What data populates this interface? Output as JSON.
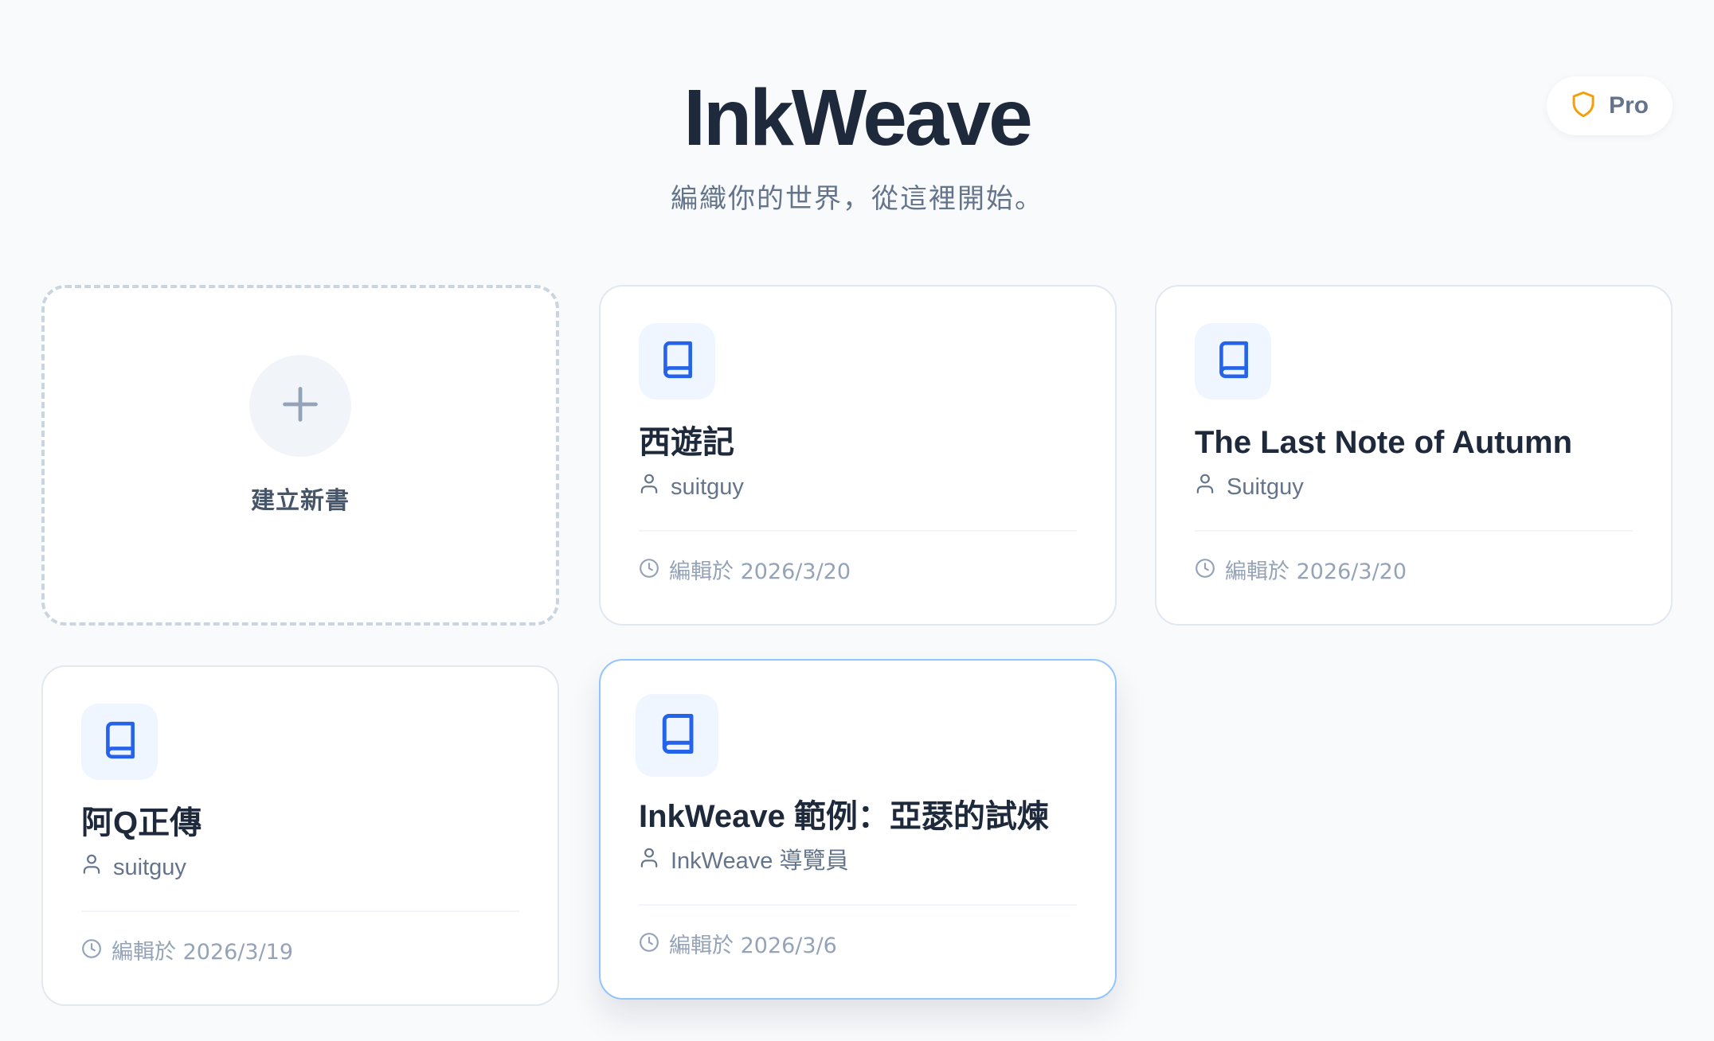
{
  "header": {
    "title": "InkWeave",
    "subtitle": "編織你的世界，從這裡開始。",
    "pro_label": "Pro"
  },
  "new_book": {
    "label": "建立新書"
  },
  "books": [
    {
      "title": "西遊記",
      "author": "suitguy",
      "edited": "編輯於 2026/3/20"
    },
    {
      "title": "The Last Note of Autumn",
      "author": "Suitguy",
      "edited": "編輯於 2026/3/20"
    },
    {
      "title": "阿Q正傳",
      "author": "suitguy",
      "edited": "編輯於 2026/3/19"
    },
    {
      "title": "InkWeave 範例：亞瑟的試煉",
      "author": "InkWeave 導覽員",
      "edited": "編輯於 2026/3/6"
    }
  ],
  "colors": {
    "accent": "#2563eb",
    "pro_shield": "#f59e0b",
    "hover_border": "#93c5fd"
  }
}
